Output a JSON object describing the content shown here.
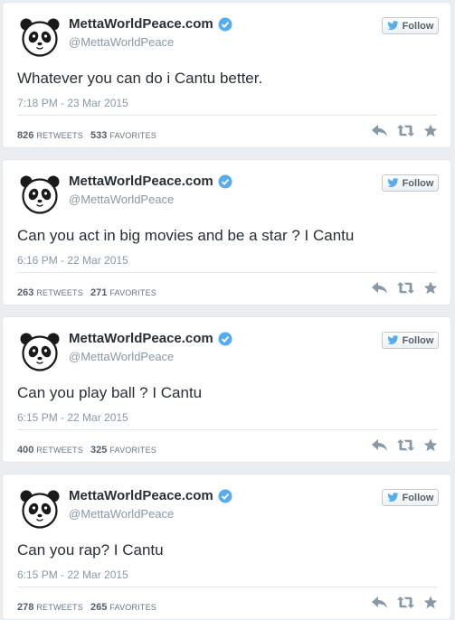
{
  "follow_label": "Follow",
  "retweets_label": "RETWEETS",
  "favorites_label": "FAVORITES",
  "colors": {
    "verified": "#55acee",
    "bird": "#55acee",
    "action_icon": "#8899a6"
  },
  "tweets": [
    {
      "name": "MettaWorldPeace.com",
      "handle": "@MettaWorldPeace",
      "text": "Whatever you can do i Cantu better.",
      "timestamp": "7:18 PM - 23 Mar 2015",
      "retweets": "826",
      "favorites": "533"
    },
    {
      "name": "MettaWorldPeace.com",
      "handle": "@MettaWorldPeace",
      "text": "Can you act in big movies and be a star ? I Cantu",
      "timestamp": "6:16 PM - 22 Mar 2015",
      "retweets": "263",
      "favorites": "271"
    },
    {
      "name": "MettaWorldPeace.com",
      "handle": "@MettaWorldPeace",
      "text": "Can you play ball ? I Cantu",
      "timestamp": "6:15 PM - 22 Mar 2015",
      "retweets": "400",
      "favorites": "325"
    },
    {
      "name": "MettaWorldPeace.com",
      "handle": "@MettaWorldPeace",
      "text": "Can you rap? I Cantu",
      "timestamp": "6:15 PM - 22 Mar 2015",
      "retweets": "278",
      "favorites": "265"
    }
  ]
}
